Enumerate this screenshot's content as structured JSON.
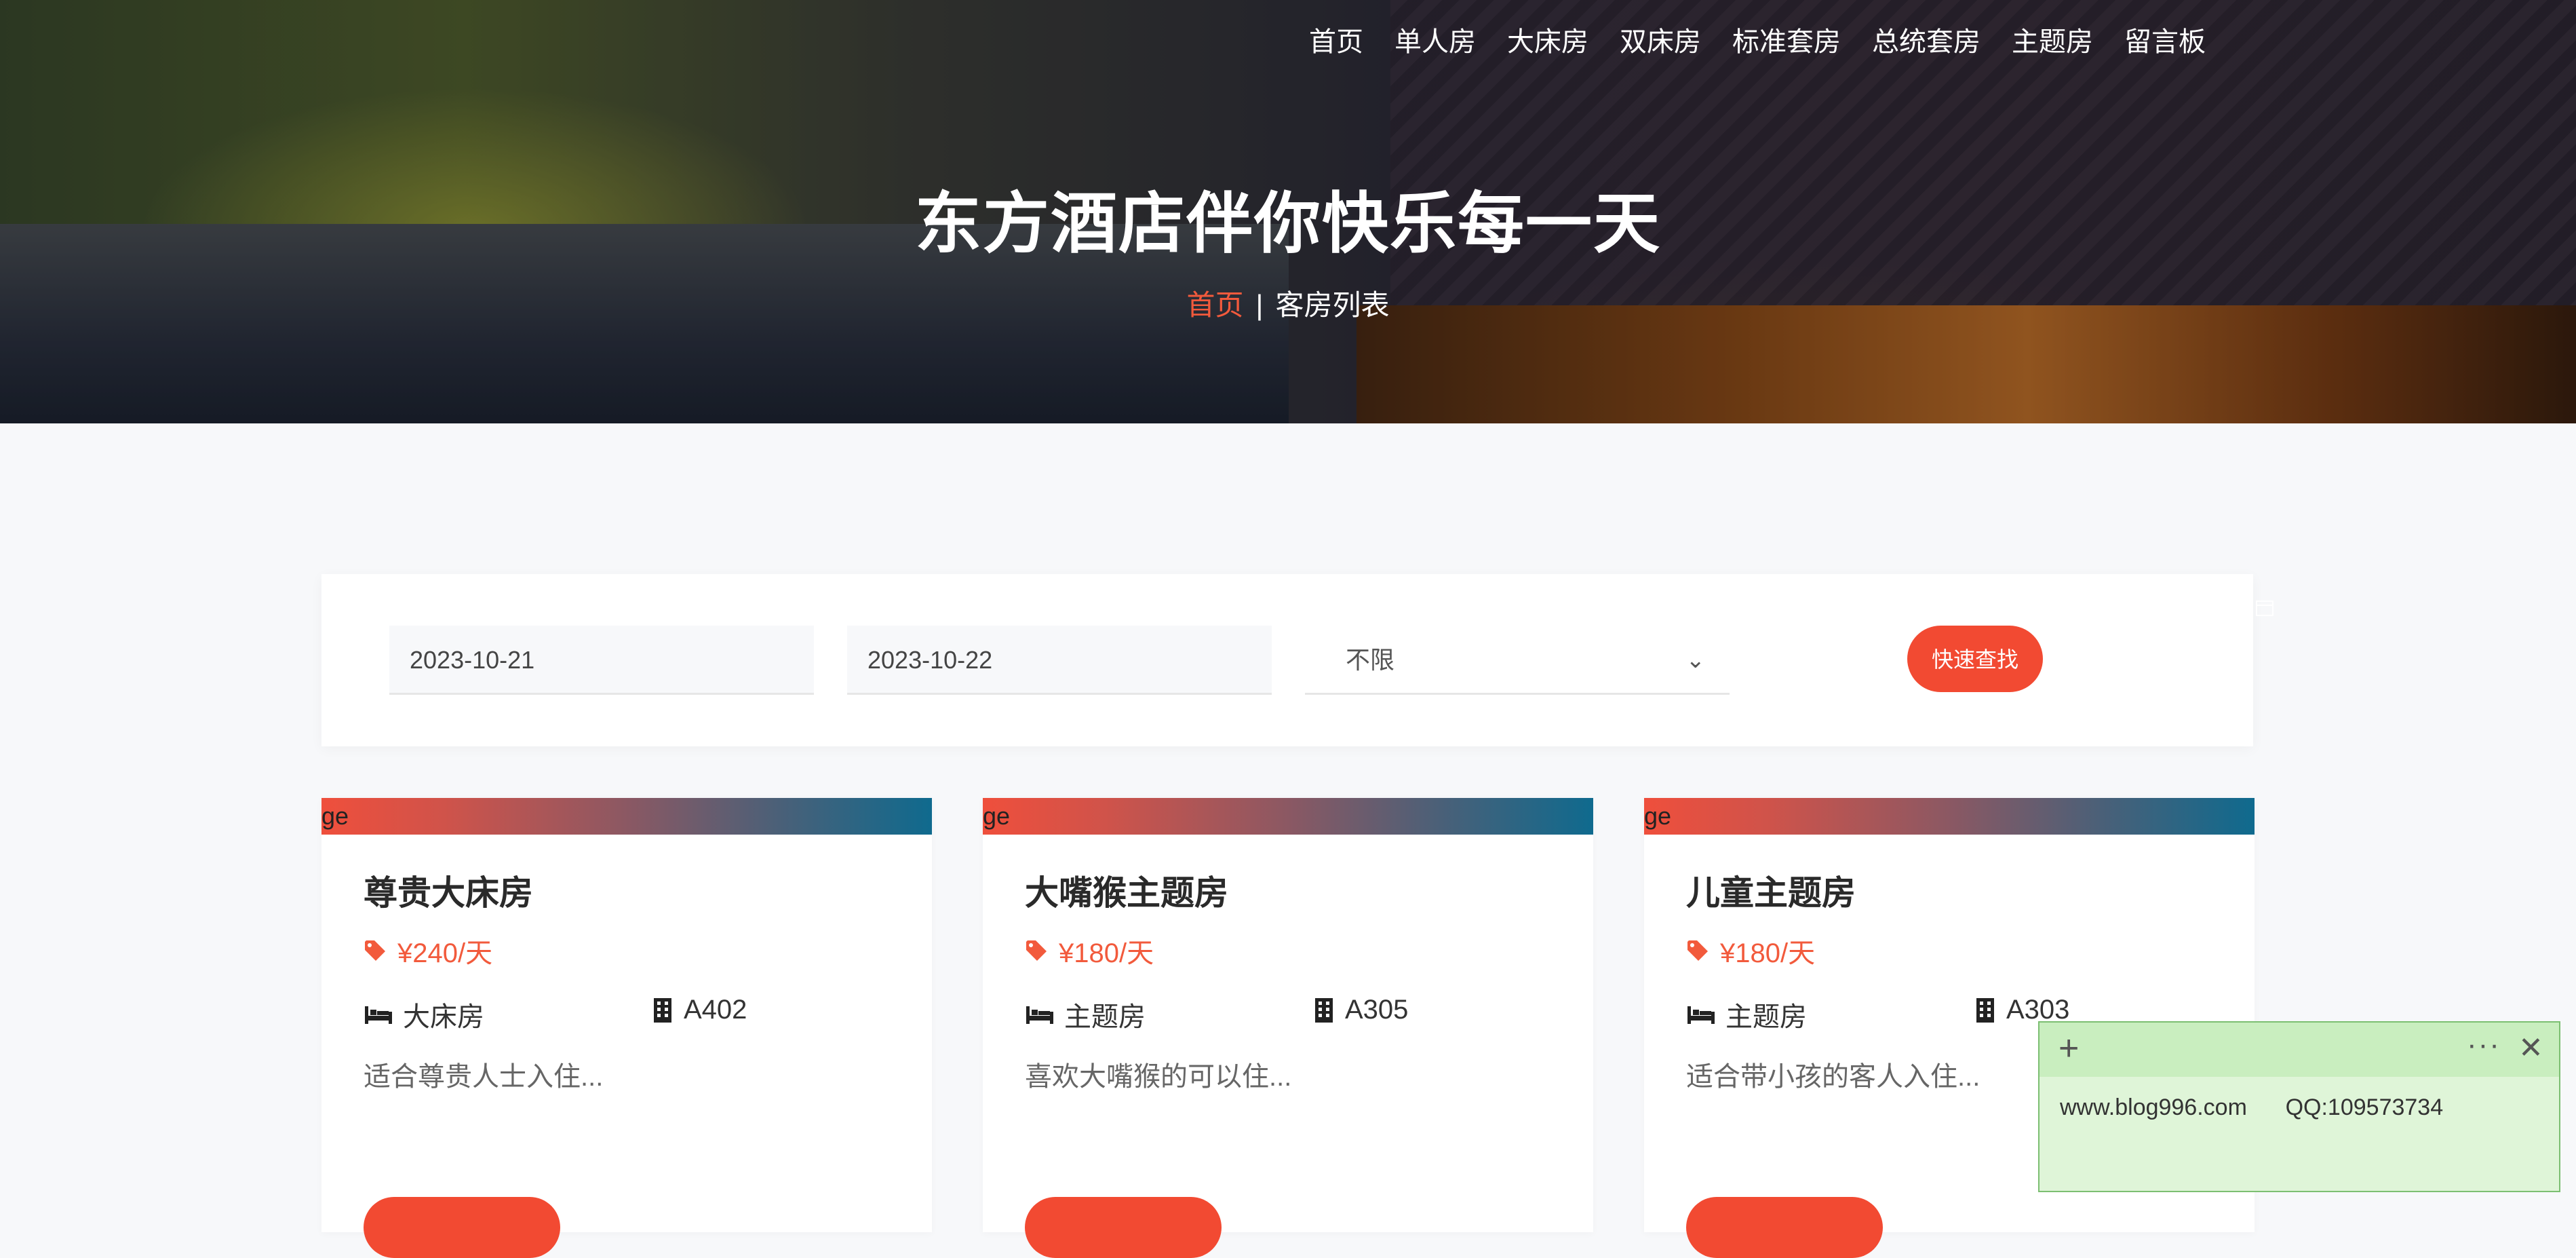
{
  "nav": {
    "items": [
      "首页",
      "单人房",
      "大床房",
      "双床房",
      "标准套房",
      "总统套房",
      "主题房",
      "留言板"
    ]
  },
  "hero": {
    "title": "东方酒店伴你快乐每一天",
    "breadcrumb_home": "首页",
    "breadcrumb_sep": "|",
    "breadcrumb_current": "客房列表"
  },
  "search": {
    "checkin": "2023-10-21",
    "checkout": "2023-10-22",
    "room_type": "不限",
    "button": "快速查找"
  },
  "rooms": [
    {
      "image_alt": "ge",
      "title": "尊贵大床房",
      "price": "¥240/天",
      "type": "大床房",
      "room_no": "A402",
      "desc": "适合尊贵人士入住..."
    },
    {
      "image_alt": "ge",
      "title": "大嘴猴主题房",
      "price": "¥180/天",
      "type": "主题房",
      "room_no": "A305",
      "desc": "喜欢大嘴猴的可以住..."
    },
    {
      "image_alt": "ge",
      "title": "儿童主题房",
      "price": "¥180/天",
      "type": "主题房",
      "room_no": "A303",
      "desc": "适合带小孩的客人入住..."
    }
  ],
  "sticky_note": {
    "text": "www.blog996.com      QQ:109573734"
  },
  "colors": {
    "accent": "#f24a32",
    "sticky_bg": "#dff5d8"
  }
}
